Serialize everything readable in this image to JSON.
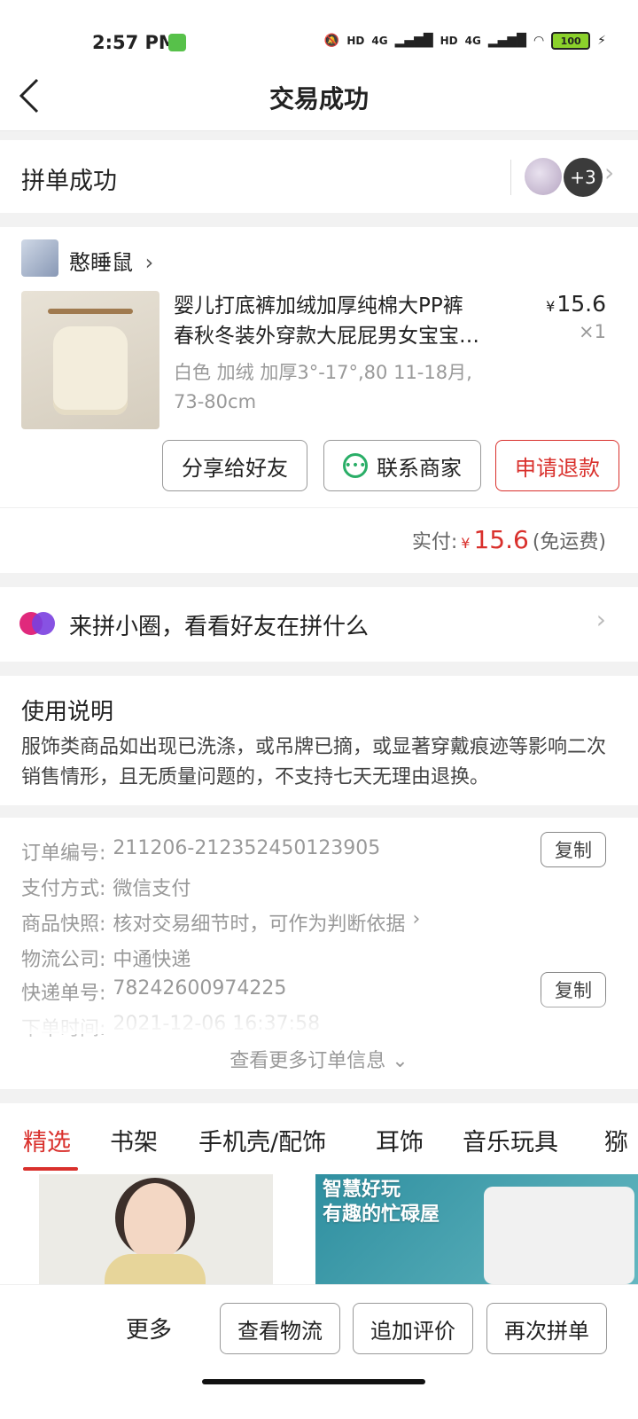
{
  "status_bar": {
    "time": "2:57 PM",
    "network1": "4G",
    "network2": "4G",
    "hd": "HD",
    "battery": "100"
  },
  "header": {
    "title": "交易成功",
    "back_icon": "back-arrow-icon"
  },
  "group": {
    "label": "拼单成功",
    "extra_count": "+3"
  },
  "shop": {
    "name": "憨睡鼠"
  },
  "product": {
    "title_line1": "婴儿打底裤加绒加厚纯棉大PP裤",
    "title_line2": "春秋冬装外穿款大屁屁男女宝宝…",
    "price_symbol": "¥",
    "price": "15.6",
    "quantity": "×1",
    "spec_line1": "白色 加绒 加厚3°-17°,80 11-18月,",
    "spec_line2": "73-80cm"
  },
  "actions": {
    "share": "分享给好友",
    "contact": "联系商家",
    "refund": "申请退款"
  },
  "payment": {
    "label": "实付:",
    "symbol": "¥",
    "amount": "15.6",
    "note": "(免运费)"
  },
  "circle": {
    "text": "来拼小圈，看看好友在拼什么"
  },
  "instructions": {
    "title": "使用说明",
    "body": "服饰类商品如出现已洗涤，或吊牌已摘，或显著穿戴痕迹等影响二次销售情形，且无质量问题的，不支持七天无理由退换。"
  },
  "order_info": {
    "order_no_label": "订单编号:",
    "order_no": "211206-212352450123905",
    "pay_method_label": "支付方式:",
    "pay_method": "微信支付",
    "snapshot_label": "商品快照:",
    "snapshot": "核对交易细节时，可作为判断依据",
    "logistics_label": "物流公司:",
    "logistics": "中通快递",
    "tracking_label": "快递单号:",
    "tracking_no": "78242600974225",
    "order_time_label": "下单时间:",
    "order_time": "2021-12-06 16:37:58",
    "copy_label": "复制",
    "more_label": "查看更多订单信息"
  },
  "tabs": [
    "精选",
    "书架",
    "手机壳/配饰",
    "耳饰",
    "音乐玩具",
    "猕"
  ],
  "feed": {
    "banner2_line1": "智慧好玩",
    "banner2_line2": "有趣的忙碌屋"
  },
  "bottom_bar": {
    "more": "更多",
    "logistics": "查看物流",
    "review": "追加评价",
    "reorder": "再次拼单"
  },
  "colors": {
    "accent_red": "#d9302c",
    "wechat_green": "#2aae67"
  }
}
